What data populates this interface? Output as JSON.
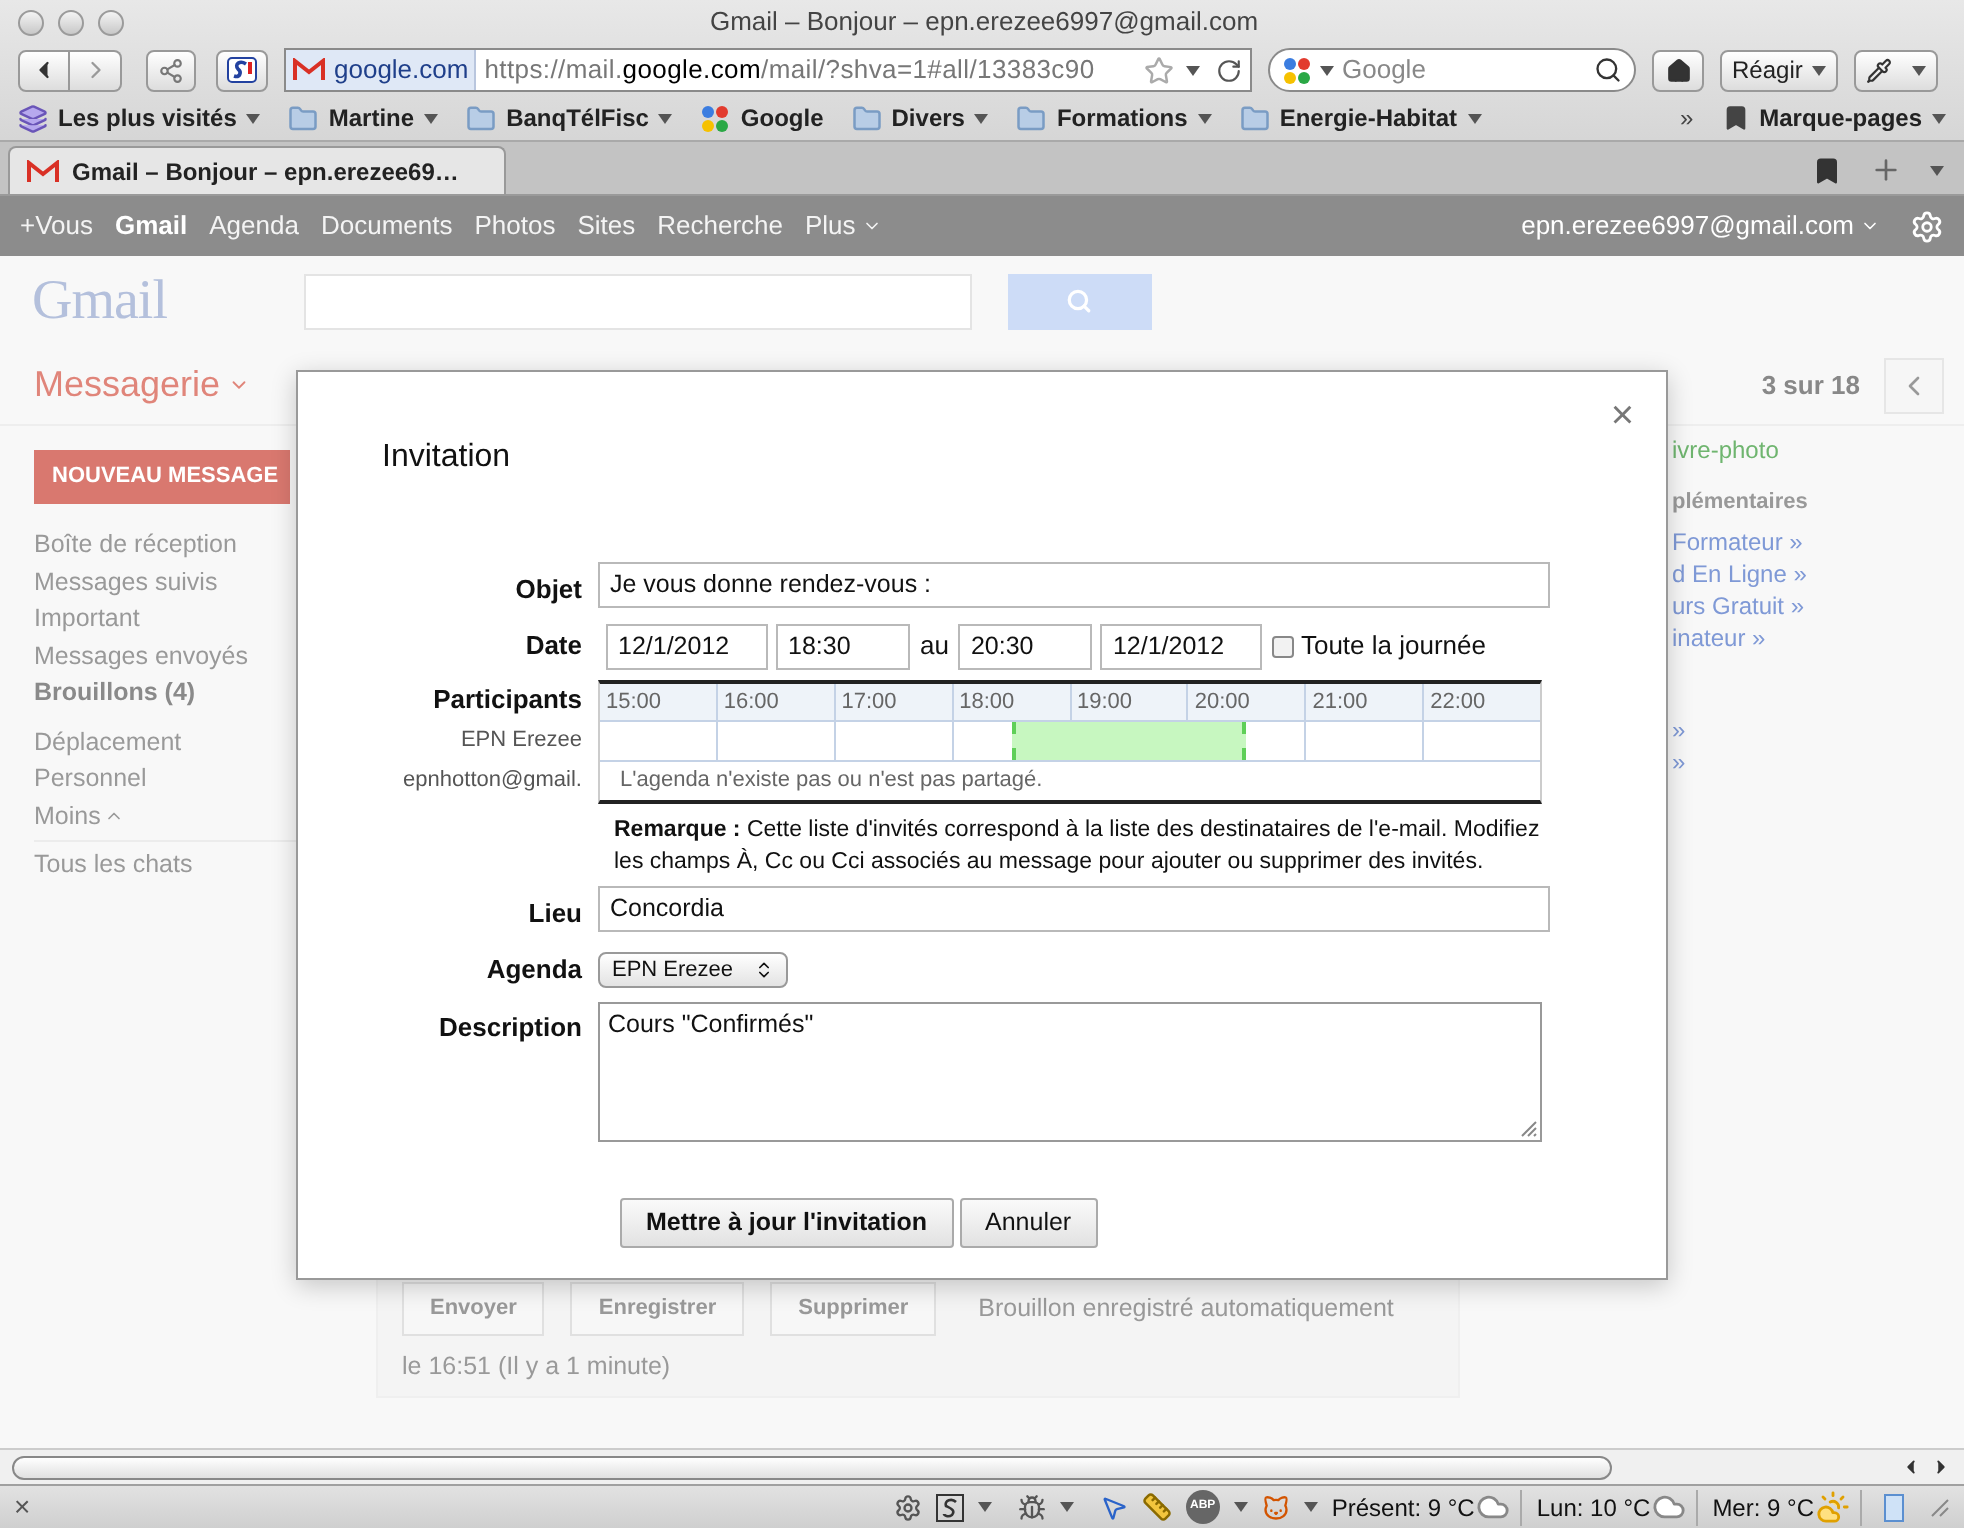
{
  "browser": {
    "title": "Gmail – Bonjour – epn.erezee6997@gmail.com",
    "site_badge": "google.com",
    "url_prefix": "https://mail.",
    "url_domain": "google.com",
    "url_rest": "/mail/?shva=1#all/13383c90",
    "search_placeholder": "Google",
    "react_button": "Réagir",
    "bookmarks": [
      {
        "label": "Les plus visités",
        "kind": "smart",
        "menu": true
      },
      {
        "label": "Martine",
        "kind": "folder",
        "menu": true
      },
      {
        "label": "BanqTélFisc",
        "kind": "folder",
        "menu": true
      },
      {
        "label": "Google",
        "kind": "site",
        "menu": false
      },
      {
        "label": "Divers",
        "kind": "folder",
        "menu": true
      },
      {
        "label": "Formations",
        "kind": "folder",
        "menu": true
      },
      {
        "label": "Energie-Habitat",
        "kind": "folder",
        "menu": true
      }
    ],
    "bookmarks_overflow": "»",
    "bookmarks_menu": "Marque-pages",
    "tabs": [
      {
        "label": "Gmail – Bonjour – epn.erezee69…",
        "selected": true
      }
    ]
  },
  "gmail": {
    "topbar": [
      {
        "label": "+Vous",
        "selected": false
      },
      {
        "label": "Gmail",
        "selected": true
      },
      {
        "label": "Agenda",
        "selected": false
      },
      {
        "label": "Documents",
        "selected": false
      },
      {
        "label": "Photos",
        "selected": false
      },
      {
        "label": "Sites",
        "selected": false
      },
      {
        "label": "Recherche",
        "selected": false
      },
      {
        "label": "Plus",
        "selected": false
      }
    ],
    "account": "epn.erezee6997@gmail.com",
    "logo": "Gmail",
    "mailbox": "Messagerie",
    "pager": "3 sur 18",
    "compose": "NOUVEAU MESSAGE",
    "folders": [
      {
        "label": "Boîte de réception",
        "unread": false
      },
      {
        "label": "Messages suivis",
        "unread": false
      },
      {
        "label": "Important",
        "unread": false
      },
      {
        "label": "Messages envoyés",
        "unread": false
      },
      {
        "label": "Brouillons (4)",
        "unread": true
      }
    ],
    "labels": [
      "Déplacement",
      "Personnel"
    ],
    "less": "Moins",
    "chats": "Tous les chats",
    "side_panel": [
      {
        "text": "ivre-photo",
        "kind": "heading"
      },
      {
        "text": "plémentaires",
        "kind": "subheading"
      },
      {
        "text": "Formateur »",
        "kind": "link"
      },
      {
        "text": "d En Ligne »",
        "kind": "link"
      },
      {
        "text": "urs Gratuit »",
        "kind": "link"
      },
      {
        "text": "inateur »",
        "kind": "link"
      },
      {
        "text": "»",
        "kind": "gap"
      },
      {
        "text": "»",
        "kind": "link"
      }
    ],
    "draft_buttons": [
      "Envoyer",
      "Enregistrer",
      "Supprimer"
    ],
    "draft_status": "Brouillon enregistré automatiquement",
    "draft_time": "le 16:51 (Il y a 1 minute)"
  },
  "dialog": {
    "title": "Invitation",
    "close": "×",
    "subject_label": "Objet",
    "subject": "Je vous donne rendez-vous :",
    "date_label": "Date",
    "start_date": "12/1/2012",
    "start_time": "18:30",
    "to": "au",
    "end_time": "20:30",
    "end_date": "12/1/2012",
    "all_day": {
      "label": "Toute la journée",
      "checked": false
    },
    "participants_label": "Participants",
    "hours": [
      "15:00",
      "16:00",
      "17:00",
      "18:00",
      "19:00",
      "20:00",
      "21:00",
      "22:00"
    ],
    "participants": [
      {
        "name": "EPN Erezee",
        "kind": "calendar"
      },
      {
        "name": "epnhotton@gmail.",
        "kind": "unavailable",
        "message": "L'agenda n'existe pas ou n'est pas partagé."
      }
    ],
    "remark": "**Remarque :** Cette liste d'invités correspond à la liste des destinataires de l'e-mail. Modifiez les champs À, Cc ou Cci associés au message pour ajouter ou supprimer des invités.",
    "place_label": "Lieu",
    "place": "Concordia",
    "calendar_label": "Agenda",
    "calendar": "EPN Erezee",
    "description_label": "Description",
    "description": "Cours \"Confirmés\"",
    "buttons": [
      {
        "label": "Mettre à jour l'invitation",
        "kind": "primary"
      },
      {
        "label": "Annuler",
        "kind": "secondary"
      }
    ]
  },
  "status_bar": {
    "close": "×",
    "adblock": "ABP",
    "weather": [
      {
        "text": "Présent: 9 °C",
        "kind": "cloud"
      },
      {
        "text": "Lun: 10 °C",
        "kind": "cloud"
      },
      {
        "text": "Mer: 9 °C",
        "kind": "sun"
      }
    ]
  }
}
